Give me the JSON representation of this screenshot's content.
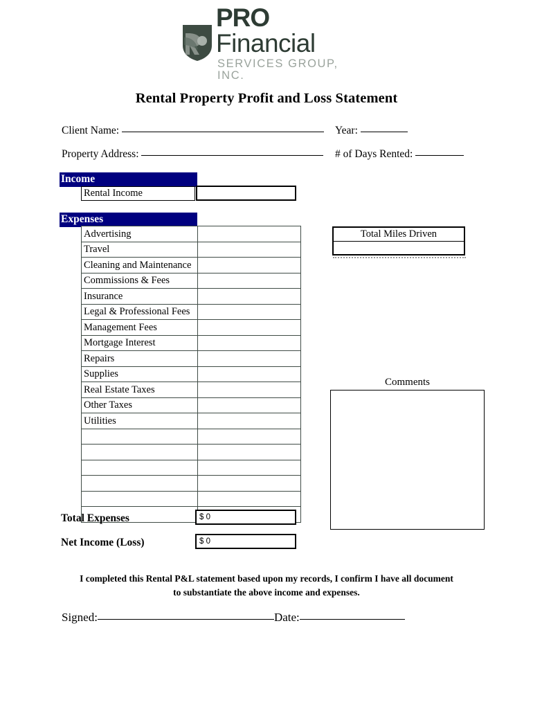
{
  "logo": {
    "icon": "shield-emblem-icon",
    "line1_bold": "PRO",
    "line1_rest": " Financial",
    "line2": "SERVICES GROUP, INC.",
    "shield_color": "#3d4b42",
    "word_color": "#2e3c34",
    "subtitle_color": "#9aa39c"
  },
  "title": "Rental Property Profit and Loss Statement",
  "fields": {
    "client_name_label": "Client Name:",
    "client_name_value": "",
    "property_address_label": "Property Address:",
    "property_address_value": "",
    "year_label": "Year:",
    "year_value": "",
    "days_rented_label": "# of Days Rented:",
    "days_rented_value": ""
  },
  "income": {
    "section_label": "Income",
    "row_label": "Rental Income",
    "row_value": ""
  },
  "expenses": {
    "section_label": "Expenses",
    "rows": [
      {
        "label": "Advertising",
        "value": ""
      },
      {
        "label": "Travel",
        "value": ""
      },
      {
        "label": "Cleaning and Maintenance",
        "value": ""
      },
      {
        "label": "Commissions & Fees",
        "value": ""
      },
      {
        "label": "Insurance",
        "value": ""
      },
      {
        "label": "Legal & Professional Fees",
        "value": ""
      },
      {
        "label": "Management Fees",
        "value": ""
      },
      {
        "label": "Mortgage Interest",
        "value": ""
      },
      {
        "label": "Repairs",
        "value": ""
      },
      {
        "label": "Supplies",
        "value": ""
      },
      {
        "label": "Real Estate Taxes",
        "value": ""
      },
      {
        "label": "Other Taxes",
        "value": ""
      },
      {
        "label": "Utilities",
        "value": ""
      },
      {
        "label": "",
        "value": ""
      },
      {
        "label": "",
        "value": ""
      },
      {
        "label": "",
        "value": ""
      },
      {
        "label": "",
        "value": ""
      },
      {
        "label": "",
        "value": ""
      },
      {
        "label": "",
        "value": ""
      }
    ]
  },
  "totals": {
    "total_expenses_label": "Total Expenses",
    "total_expenses_value": "$ 0",
    "net_income_label": "Net Income (Loss)",
    "net_income_value": "$ 0"
  },
  "miles": {
    "header": "Total Miles Driven",
    "value": ""
  },
  "comments": {
    "label": "Comments",
    "value": ""
  },
  "attestation": {
    "line1": "I completed this Rental P&L statement based upon my records, I confirm I have all document",
    "line2": "to substantiate the above income and expenses."
  },
  "signature": {
    "signed_label": "Signed:",
    "signed_value": "",
    "date_label": "Date:",
    "date_value": ""
  },
  "colors": {
    "section_bar": "#00007f",
    "section_bar_text": "#ffffff",
    "border": "#000000",
    "table_border": "#3f4b45"
  }
}
